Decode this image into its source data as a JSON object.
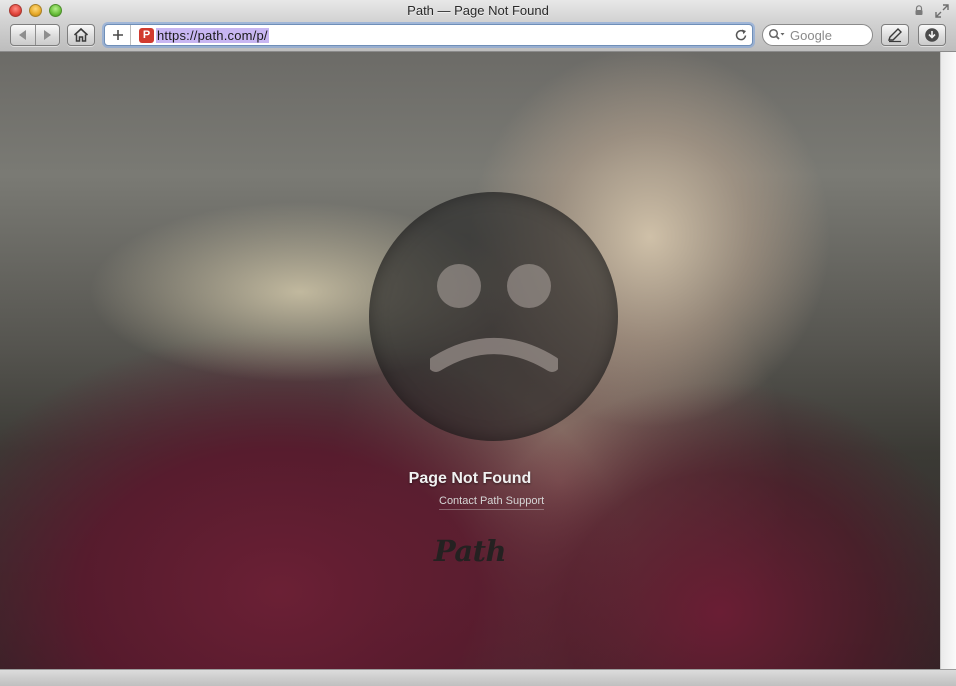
{
  "window": {
    "title": "Path — Page Not Found"
  },
  "toolbar": {
    "url": "https://path.com/p/",
    "favicon_letter": "P",
    "search_placeholder": "Google"
  },
  "page": {
    "heading": "Page Not Found",
    "support_link": "Contact Path Support",
    "brand": "Path"
  },
  "colors": {
    "url_selection": "#c8b6f2",
    "favicon_bg": "#d13a2e",
    "focus_ring": "#7aa0dc"
  },
  "icons": [
    "close-icon",
    "minimize-icon",
    "zoom-icon",
    "lock-icon",
    "fullscreen-icon",
    "back-icon",
    "forward-icon",
    "home-icon",
    "plus-icon",
    "reload-icon",
    "search-icon",
    "reader-icon",
    "download-icon",
    "sad-face-icon"
  ]
}
